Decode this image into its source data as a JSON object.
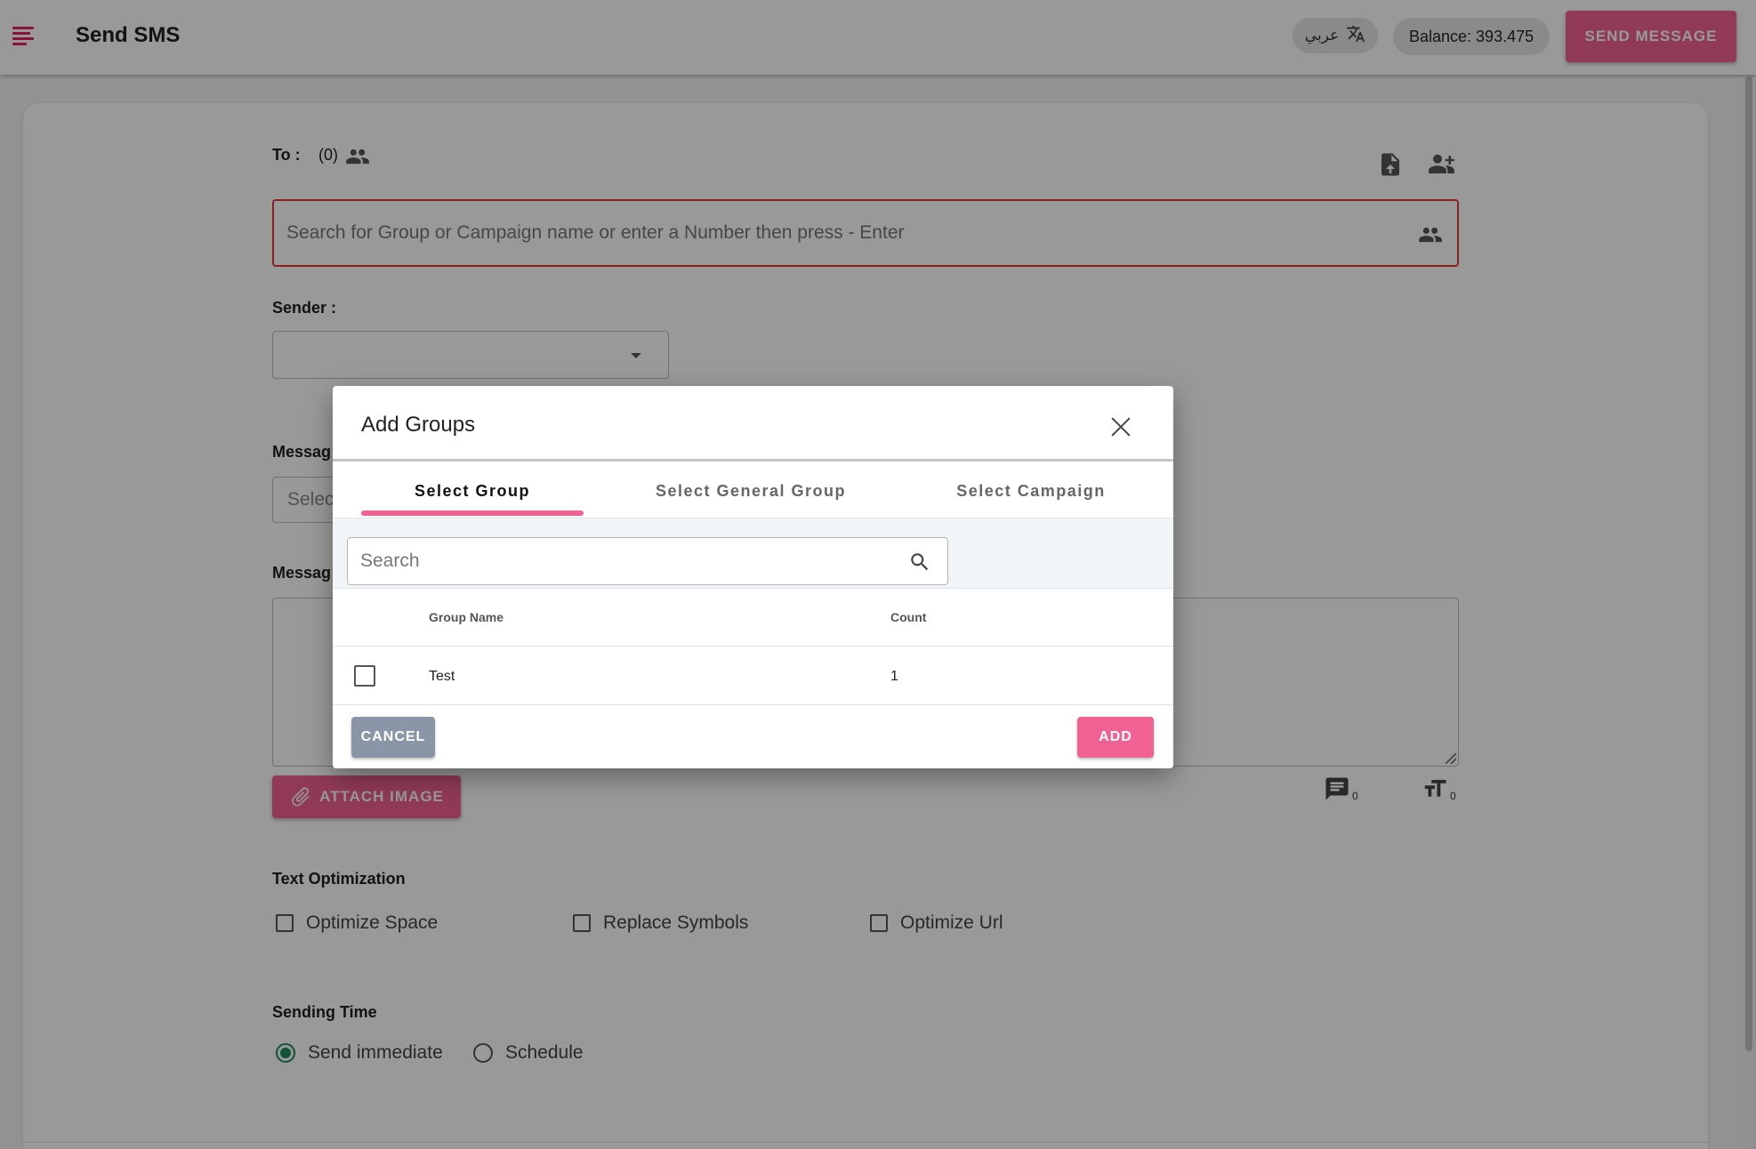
{
  "app": {
    "title": "Send SMS",
    "language_label": "عربي",
    "balance": "Balance: 393.475",
    "send_button": "SEND MESSAGE"
  },
  "form": {
    "to_label": "To :",
    "to_count": "(0)",
    "search_placeholder": "Search for Group or Campaign name or enter a Number then press - Enter",
    "sender_label": "Sender :",
    "sender_value": "",
    "message_type_label": "Messag",
    "message_type_placeholder": "Selec",
    "message_label": "Messag",
    "attach_button": "ATTACH IMAGE",
    "message_count": "0",
    "char_count": "0",
    "text_optimization_label": "Text Optimization",
    "optimizations": [
      "Optimize Space",
      "Replace Symbols",
      "Optimize Url"
    ],
    "sending_time_label": "Sending Time",
    "sending_options": [
      "Send immediate",
      "Schedule"
    ],
    "sending_selected": "Send immediate"
  },
  "dialog": {
    "title": "Add Groups",
    "tabs": [
      {
        "label": "Select Group",
        "active": true
      },
      {
        "label": "Select General Group",
        "active": false
      },
      {
        "label": "Select Campaign",
        "active": false
      }
    ],
    "search_placeholder": "Search",
    "columns": [
      "Group Name",
      "Count"
    ],
    "rows": [
      {
        "name": "Test",
        "count": "1",
        "checked": false
      }
    ],
    "cancel_button": "CANCEL",
    "add_button": "ADD"
  },
  "colors": {
    "accent": "#f06292",
    "error_border": "#e53935",
    "radio_selected": "#1b8a5a",
    "cancel_button": "#8a96a8"
  },
  "icons": [
    "menu-icon",
    "translate-icon",
    "people-icon",
    "upload-file-icon",
    "add-person-icon",
    "paperclip-icon",
    "message-count-icon",
    "text-size-icon",
    "close-icon",
    "search-icon"
  ]
}
